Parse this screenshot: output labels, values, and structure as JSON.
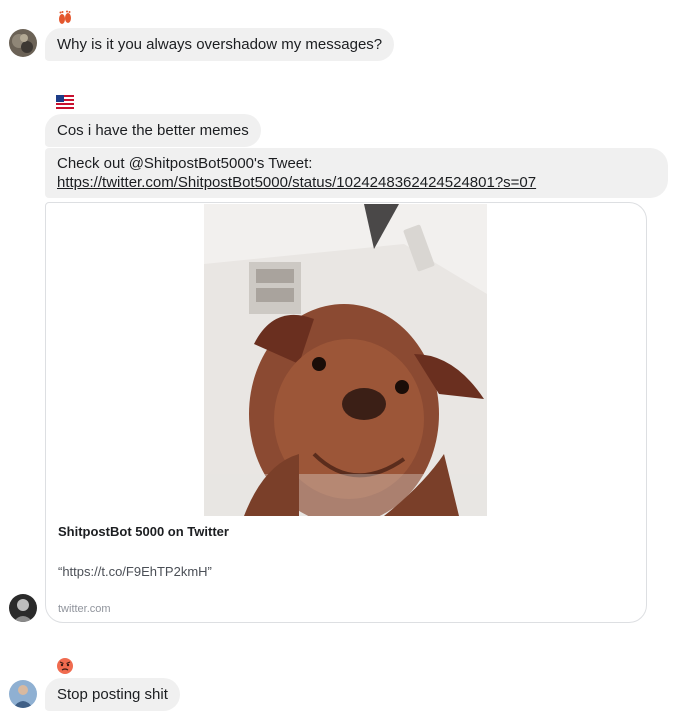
{
  "thread": {
    "group1": {
      "reaction_icon": "feet-icon",
      "messages": [
        {
          "text": "Why is it you always overshadow my messages?"
        }
      ]
    },
    "group2": {
      "reaction_icon": "us-flag-icon",
      "messages": [
        {
          "text": "Cos i have the better memes"
        },
        {
          "line1": "Check out @ShitpostBot5000's Tweet:",
          "link": "https://twitter.com/ShitpostBot5000/status/1024248362424524801?s=07"
        }
      ],
      "link_card": {
        "image": "dog-photo",
        "title": "ShitpostBot 5000 on Twitter",
        "description": "“https://t.co/F9EhTP2kmH”",
        "domain": "twitter.com"
      }
    },
    "group3": {
      "reaction_icon": "angry-face-icon",
      "messages": [
        {
          "text": "Stop posting shit"
        }
      ]
    }
  },
  "colors": {
    "bubble_bg": "#f0f0f0",
    "card_border": "#dddfe2",
    "text": "#1c1e21",
    "muted": "#90949c"
  }
}
